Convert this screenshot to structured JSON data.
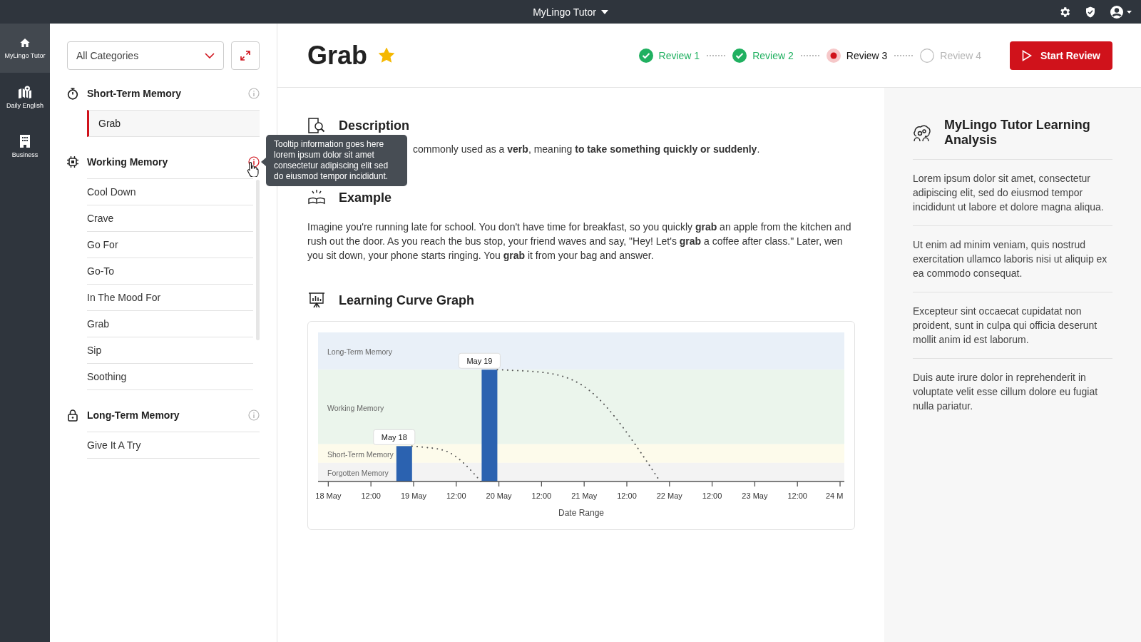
{
  "topbar": {
    "title": "MyLingo Tutor"
  },
  "nav": [
    {
      "label": "MyLingo Tutor",
      "kind": "home",
      "selected": true
    },
    {
      "label": "Daily English",
      "kind": "map",
      "selected": false
    },
    {
      "label": "Business",
      "kind": "building",
      "selected": false
    }
  ],
  "filter": {
    "value": "All Categories"
  },
  "categories": [
    {
      "title": "Short-Term Memory",
      "kind": "timer",
      "info_active": false,
      "items": [
        {
          "label": "Grab",
          "selected": true
        }
      ]
    },
    {
      "title": "Working Memory",
      "kind": "chip",
      "info_active": true,
      "items": [
        {
          "label": "Cool Down",
          "selected": false
        },
        {
          "label": "Crave",
          "selected": false
        },
        {
          "label": "Go For",
          "selected": false
        },
        {
          "label": "Go-To",
          "selected": false
        },
        {
          "label": "In The Mood For",
          "selected": false
        },
        {
          "label": "Grab",
          "selected": false
        },
        {
          "label": "Sip",
          "selected": false
        },
        {
          "label": "Soothing",
          "selected": false
        }
      ]
    },
    {
      "title": "Long-Term Memory",
      "kind": "lock",
      "info_active": false,
      "items": [
        {
          "label": "Give It A Try",
          "selected": false
        }
      ]
    }
  ],
  "tooltip": {
    "text": "Tooltip information goes here lorem ipsum dolor sit amet consectetur adipiscing elit sed do eiusmod tempor incididunt."
  },
  "word": {
    "title": "Grab",
    "favorite": true
  },
  "reviews": [
    {
      "label": "Review 1",
      "done": true,
      "selected": false
    },
    {
      "label": "Review 2",
      "done": true,
      "selected": false
    },
    {
      "label": "Review 3",
      "done": false,
      "selected": true
    },
    {
      "label": "Review 4",
      "done": false,
      "selected": false
    }
  ],
  "start_button": "Start Review",
  "description": {
    "heading": "Description",
    "text": "commonly used as a **verb**, meaning **to take something quickly or suddenly**."
  },
  "example": {
    "heading": "Example",
    "text": "Imagine you're running late for school. You don't have time for breakfast, so you quickly **grab** an apple from the kitchen and rush out the door. As you reach the bus stop, your friend waves and say, \"Hey! Let's **grab** a coffee after class.\" Later, wen you sit down, your phone starts ringing. You **grab** it from your bag and answer."
  },
  "graph": {
    "heading": "Learning Curve Graph",
    "axis_title": "Date Range",
    "ticks": [
      "18 May",
      "12:00",
      "19 May",
      "12:00",
      "20 May",
      "12:00",
      "21 May",
      "12:00",
      "22 May",
      "12:00",
      "23 May",
      "12:00",
      "24 M"
    ],
    "callouts": [
      "May 18",
      "May 19"
    ],
    "bands": [
      {
        "label": "Long-Term Memory",
        "color": "#e9f0f8"
      },
      {
        "label": "Working Memory",
        "color": "#ebf5ec"
      },
      {
        "label": "Short-Term Memory",
        "color": "#fdfbeb"
      },
      {
        "label": "Forgotten Memory",
        "color": "#f3f3f3"
      }
    ]
  },
  "analysis": {
    "title": "MyLingo Tutor Learning Analysis",
    "paragraphs": [
      "Lorem ipsum dolor sit amet, consectetur adipiscing elit, sed do eiusmod tempor incididunt ut labore et dolore magna aliqua.",
      "Ut enim ad minim veniam, quis nostrud exercitation ullamco laboris nisi ut aliquip ex ea commodo consequat.",
      "Excepteur sint occaecat cupidatat non proident, sunt in culpa qui officia deserunt mollit anim id est laborum.",
      "Duis aute irure dolor in reprehenderit in voluptate velit esse cillum dolore eu fugiat nulla pariatur."
    ]
  }
}
